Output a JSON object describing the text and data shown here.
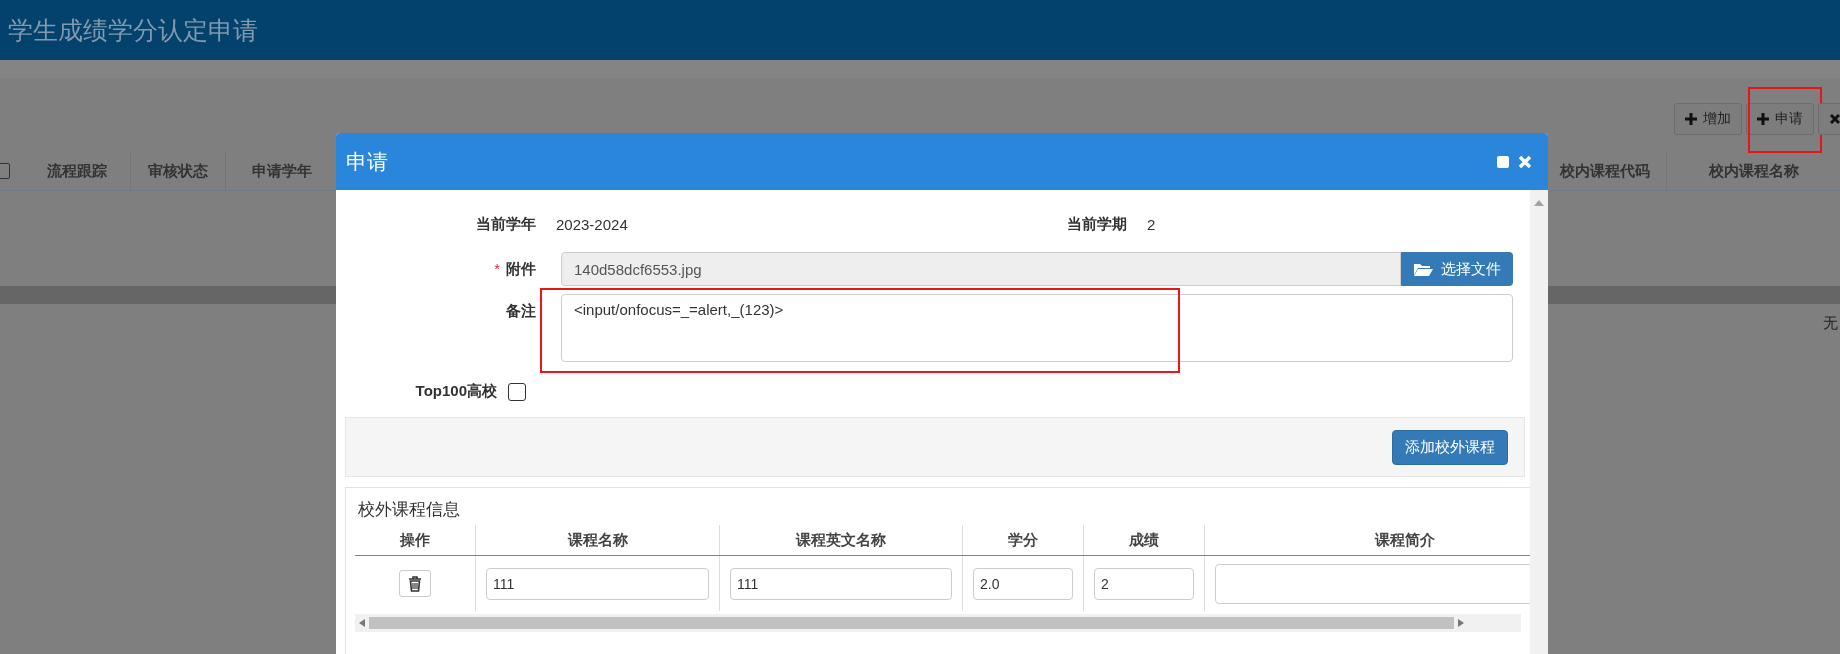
{
  "page": {
    "title": "学生成绩学分认定申请"
  },
  "toolbar": [
    {
      "kind": "add",
      "label": "增加",
      "annotated": false
    },
    {
      "kind": "add",
      "label": "申请",
      "annotated": true
    },
    {
      "kind": "delete"
    }
  ],
  "table": {
    "select_all": {
      "checked": false
    },
    "columns_left": [
      "流程跟踪",
      "审核状态",
      "申请学年"
    ],
    "columns_right": [
      "校内课程代码",
      "校内课程名称"
    ],
    "empty_text": "无"
  },
  "dialog": {
    "title": "申请",
    "year": {
      "label": "当前学年",
      "value": "2023-2024"
    },
    "term": {
      "label": "当前学期",
      "value": "2"
    },
    "attachment": {
      "label": "附件",
      "required": true,
      "required_mark": "*",
      "value": "140d58dcf6553.jpg",
      "button": "选择文件"
    },
    "remark": {
      "label": "备注",
      "value": "<input/onfocus=_=alert,_(123)>",
      "annotated": true
    },
    "top100": {
      "label": "Top100高校",
      "checked": false
    },
    "add_button": "添加校外课程",
    "courses": {
      "title": "校外课程信息",
      "columns": [
        "操作",
        "课程名称",
        "课程英文名称",
        "学分",
        "成绩",
        "课程简介"
      ],
      "rows": [
        {
          "name": "111",
          "english_name": "111",
          "credit": "2.0",
          "score": "2"
        }
      ]
    }
  }
}
